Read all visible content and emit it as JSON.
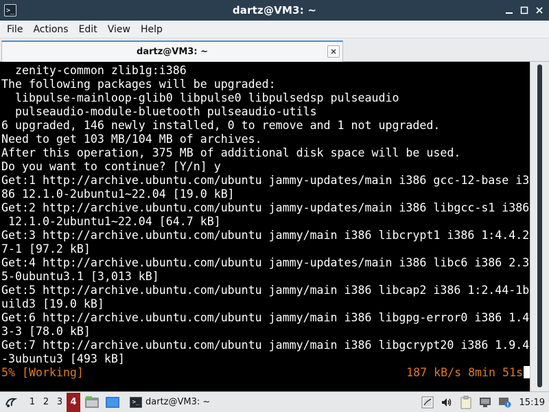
{
  "window": {
    "title": "dartz@VM3: ~",
    "controls": [
      "minimize",
      "maximize",
      "close"
    ]
  },
  "menu": [
    "File",
    "Actions",
    "Edit",
    "View",
    "Help"
  ],
  "tab": {
    "label": "dartz@VM3: ~"
  },
  "terminal": {
    "lines": [
      "  zenity-common zlib1g:i386",
      "The following packages will be upgraded:",
      "  libpulse-mainloop-glib0 libpulse0 libpulsedsp pulseaudio",
      "  pulseaudio-module-bluetooth pulseaudio-utils",
      "6 upgraded, 146 newly installed, 0 to remove and 1 not upgraded.",
      "Need to get 103 MB/104 MB of archives.",
      "After this operation, 375 MB of additional disk space will be used.",
      "Do you want to continue? [Y/n] y",
      "Get:1 http://archive.ubuntu.com/ubuntu jammy-updates/main i386 gcc-12-base i3",
      "86 12.1.0-2ubuntu1~22.04 [19.0 kB]",
      "Get:2 http://archive.ubuntu.com/ubuntu jammy-updates/main i386 libgcc-s1 i386",
      " 12.1.0-2ubuntu1~22.04 [64.7 kB]",
      "Get:3 http://archive.ubuntu.com/ubuntu jammy/main i386 libcrypt1 i386 1:4.4.2",
      "7-1 [97.2 kB]",
      "Get:4 http://archive.ubuntu.com/ubuntu jammy-updates/main i386 libc6 i386 2.3",
      "5-0ubuntu3.1 [3,013 kB]",
      "Get:5 http://archive.ubuntu.com/ubuntu jammy/main i386 libcap2 i386 1:2.44-1b",
      "uild3 [19.0 kB]",
      "Get:6 http://archive.ubuntu.com/ubuntu jammy/main i386 libgpg-error0 i386 1.4",
      "3-3 [78.0 kB]",
      "Get:7 http://archive.ubuntu.com/ubuntu jammy/main i386 libgcrypt20 i386 1.9.4",
      "-3ubuntu3 [493 kB]"
    ],
    "status_left": "5% [Working]",
    "status_right": "187 kB/s 8min 51s",
    "status_color": "#e07a1e"
  },
  "taskbar": {
    "workspaces": [
      "1",
      "2",
      "3",
      "4"
    ],
    "active_workspace": "4",
    "launchers": [
      "file-manager-icon",
      "desktop-icon"
    ],
    "task_label": "dartz@VM3: ~",
    "tray": [
      "sensor-icon",
      "volume-icon",
      "clipboard-icon",
      "network-icon",
      "update-notifier-icon"
    ],
    "clock": "15:19"
  },
  "colors": {
    "titlebar": "#2b3e50",
    "accent": "#4d8fcc",
    "active_workspace": "#9b1c1c"
  }
}
